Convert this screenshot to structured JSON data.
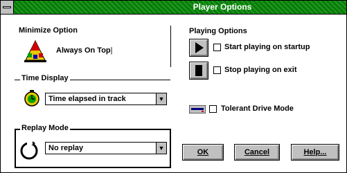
{
  "window": {
    "title": "Player Options"
  },
  "minimize": {
    "heading": "Minimize Option",
    "always_on_top": "Always On Top"
  },
  "time_display": {
    "heading": "Time Display",
    "selected": "Time elapsed in track"
  },
  "replay_mode": {
    "heading": "Replay Mode",
    "selected": "No replay"
  },
  "playing": {
    "heading": "Playing Options",
    "start_label": "Start playing on startup",
    "stop_label": "Stop playing on exit",
    "tolerant_label": "Tolerant Drive Mode"
  },
  "buttons": {
    "ok": "OK",
    "cancel": "Cancel",
    "help": "Help..."
  },
  "colors": {
    "titlebar": "#0a7a0a",
    "face": "#c0c0c0"
  }
}
